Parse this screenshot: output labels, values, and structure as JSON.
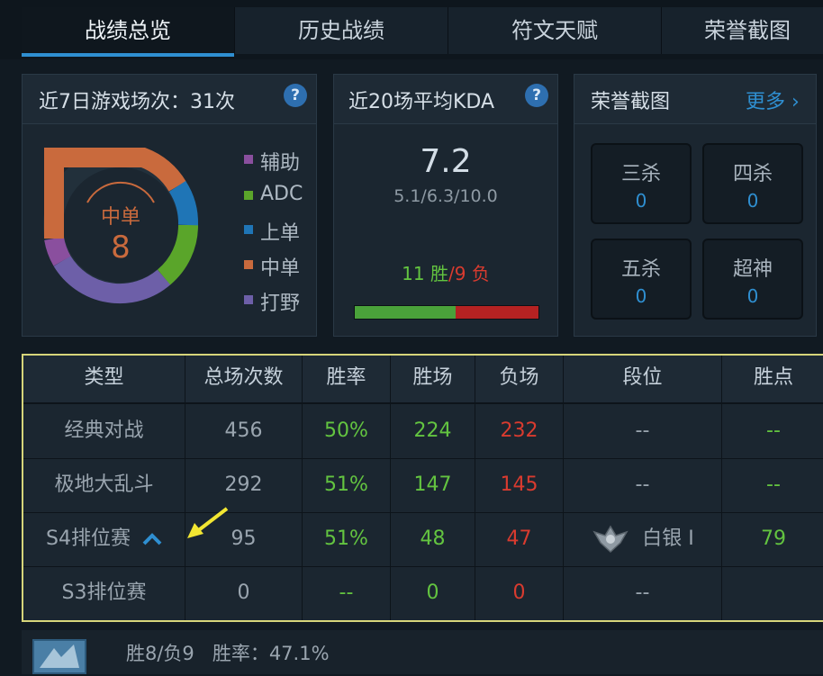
{
  "tabs": [
    "战绩总览",
    "历史战绩",
    "符文天赋",
    "荣誉截图"
  ],
  "recent_games": {
    "title": "近7日游戏场次：31次",
    "help": "?",
    "center_label": "中单",
    "center_value": "8",
    "legend": [
      {
        "label": "辅助",
        "color": "#8a4f9e"
      },
      {
        "label": "ADC",
        "color": "#5aa52a"
      },
      {
        "label": "上单",
        "color": "#1f75b6"
      },
      {
        "label": "中单",
        "color": "#c96a3d"
      },
      {
        "label": "打野",
        "color": "#6d5fa8"
      }
    ]
  },
  "kda": {
    "title": "近20场平均KDA",
    "help": "?",
    "value": "7.2",
    "detail": "5.1/6.3/10.0",
    "wins": "11 胜",
    "sep": "/",
    "losses": "9 负",
    "win_fraction": 0.55,
    "win_color": "#4aa23a",
    "loss_color": "#b52222"
  },
  "honor": {
    "title": "荣誉截图",
    "more": "更多",
    "more_arrow": "›",
    "items": [
      {
        "label": "三杀",
        "value": "0"
      },
      {
        "label": "四杀",
        "value": "0"
      },
      {
        "label": "五杀",
        "value": "0"
      },
      {
        "label": "超神",
        "value": "0"
      }
    ]
  },
  "table": {
    "headers": [
      "类型",
      "总场次数",
      "胜率",
      "胜场",
      "负场",
      "段位",
      "胜点"
    ],
    "rows": [
      {
        "type": "经典对战",
        "total": "456",
        "rate": "50%",
        "wins": "224",
        "losses": "232",
        "rank": "--",
        "points": "--"
      },
      {
        "type": "极地大乱斗",
        "total": "292",
        "rate": "51%",
        "wins": "147",
        "losses": "145",
        "rank": "--",
        "points": "--"
      },
      {
        "type": "S4排位赛",
        "total": "95",
        "rate": "51%",
        "wins": "48",
        "losses": "47",
        "rank": "白银 I",
        "points": "79"
      },
      {
        "type": "S3排位赛",
        "total": "0",
        "rate": "--",
        "wins": "0",
        "losses": "0",
        "rank": "--",
        "points": ""
      }
    ]
  },
  "footer": {
    "summary": "胜8/负9   胜率：47.1%"
  }
}
